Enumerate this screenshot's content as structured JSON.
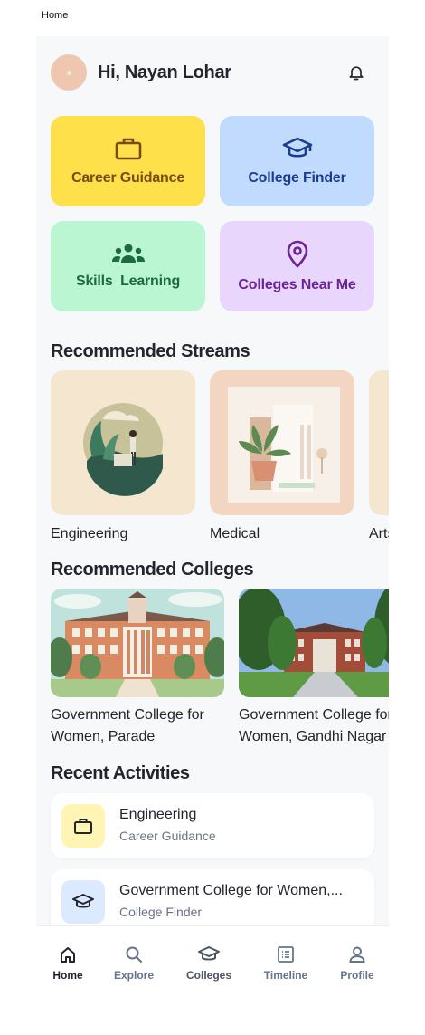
{
  "page": {
    "label": "Home"
  },
  "header": {
    "greeting": "Hi, Nayan Lohar"
  },
  "quick_actions": [
    {
      "label": "Career Guidance",
      "icon": "briefcase-icon",
      "bg": "#fee14a",
      "fg": "#7a4a12"
    },
    {
      "label": "College Finder",
      "icon": "graduation-cap-icon",
      "bg": "#c0dbfd",
      "fg": "#1d3c8f"
    },
    {
      "label": "Skills  Learning",
      "icon": "group-icon",
      "bg": "#bbf6d3",
      "fg": "#1c6b3f"
    },
    {
      "label": "Colleges Near Me",
      "icon": "map-pin-icon",
      "bg": "#e9d6fd",
      "fg": "#6b2396"
    }
  ],
  "streams": {
    "title": "Recommended Streams",
    "items": [
      {
        "label": "Engineering"
      },
      {
        "label": "Medical"
      },
      {
        "label": "Arts"
      }
    ]
  },
  "colleges": {
    "title": "Recommended Colleges",
    "items": [
      {
        "name_line1": "Government College for",
        "name_line2": "Women, Parade"
      },
      {
        "name_line1": "Government College for",
        "name_line2": "Women, Gandhi Nagar"
      }
    ]
  },
  "activities": {
    "title": "Recent Activities",
    "items": [
      {
        "title": "Engineering",
        "subtitle": "Career Guidance",
        "icon": "briefcase-icon",
        "icon_bg": "#fef4b3"
      },
      {
        "title": "Government College for Women,...",
        "subtitle": "College Finder",
        "icon": "graduation-cap-icon",
        "icon_bg": "#dbeafe"
      }
    ]
  },
  "tabbar": {
    "active": "Home",
    "items": [
      {
        "label": "Home",
        "icon": "home-icon"
      },
      {
        "label": "Explore",
        "icon": "search-icon"
      },
      {
        "label": "Colleges",
        "icon": "graduation-cap-icon"
      },
      {
        "label": "Timeline",
        "icon": "list-icon"
      },
      {
        "label": "Profile",
        "icon": "user-icon"
      }
    ]
  },
  "colors": {
    "active_tab": "#1f2430",
    "inactive_tab": "#64748b",
    "bold_tab": "#4b5563"
  }
}
